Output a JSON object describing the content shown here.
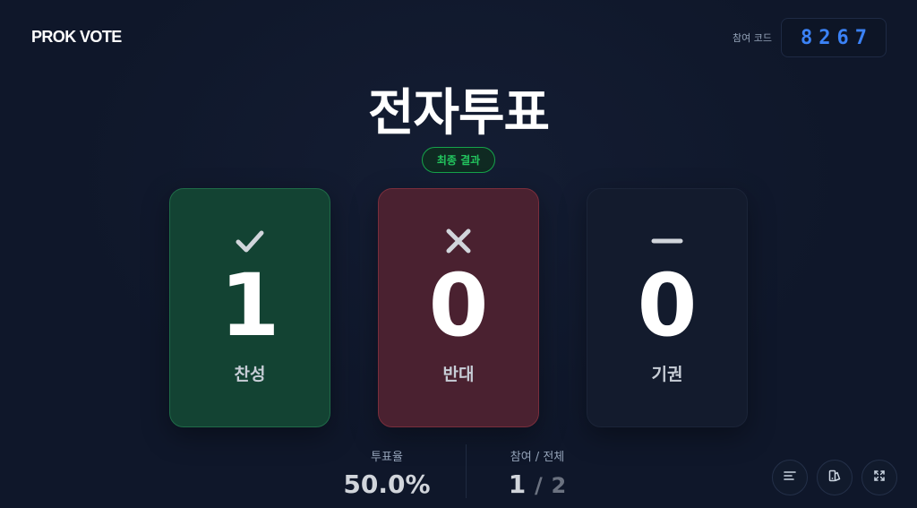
{
  "header": {
    "logo": "PROK VOTE",
    "code_label": "참여 코드",
    "code_value": "8267"
  },
  "title": "전자투표",
  "badge": "최종 결과",
  "cards": [
    {
      "label": "찬성",
      "count": "1",
      "icon": "check-icon",
      "color": "#22c55e"
    },
    {
      "label": "반대",
      "count": "0",
      "icon": "x-icon",
      "color": "#ef4444"
    },
    {
      "label": "기권",
      "count": "0",
      "icon": "minus-icon",
      "color": "#64748b"
    }
  ],
  "stats": {
    "rate_label": "투표율",
    "rate_value": "50.0%",
    "participation_label": "참여 / 전체",
    "participated": "1",
    "separator": "/",
    "total": "2"
  },
  "controls": {
    "icons": [
      "menu-lines-icon",
      "theme-icon",
      "fullscreen-icon"
    ]
  },
  "colors": {
    "background": "#0f172a",
    "accent_blue": "#3b82f6",
    "accent_green": "#22c55e"
  }
}
